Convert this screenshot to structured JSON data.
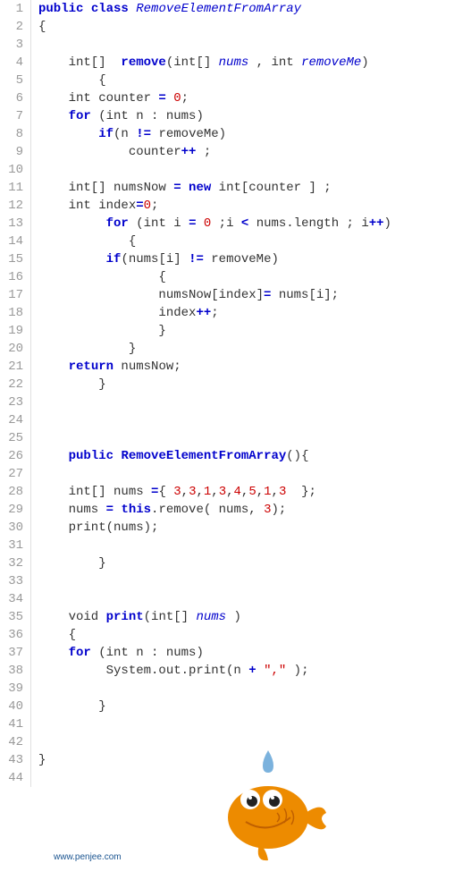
{
  "gutter": {
    "start": 1,
    "end": 44
  },
  "code": {
    "lines": [
      {
        "indent": 0,
        "tokens": [
          {
            "t": "kw",
            "v": "public"
          },
          {
            "t": "txt",
            "v": " "
          },
          {
            "t": "kw",
            "v": "class"
          },
          {
            "t": "txt",
            "v": " "
          },
          {
            "t": "classname",
            "v": "RemoveElementFromArray"
          }
        ]
      },
      {
        "indent": 0,
        "tokens": [
          {
            "t": "txt",
            "v": "{"
          }
        ]
      },
      {
        "indent": 0,
        "tokens": []
      },
      {
        "indent": 1,
        "tokens": [
          {
            "t": "txt",
            "v": "int[]  "
          },
          {
            "t": "method",
            "v": "remove"
          },
          {
            "t": "txt",
            "v": "(int[] "
          },
          {
            "t": "ident",
            "v": "nums"
          },
          {
            "t": "txt",
            "v": " , int "
          },
          {
            "t": "ident",
            "v": "removeMe"
          },
          {
            "t": "txt",
            "v": ")"
          }
        ]
      },
      {
        "indent": 2,
        "tokens": [
          {
            "t": "txt",
            "v": "{"
          }
        ]
      },
      {
        "indent": 1,
        "tokens": [
          {
            "t": "txt",
            "v": "int counter "
          },
          {
            "t": "op",
            "v": "="
          },
          {
            "t": "txt",
            "v": " "
          },
          {
            "t": "num",
            "v": "0"
          },
          {
            "t": "txt",
            "v": ";"
          }
        ]
      },
      {
        "indent": 1,
        "tokens": [
          {
            "t": "kw",
            "v": "for"
          },
          {
            "t": "txt",
            "v": " (int n : nums)"
          }
        ]
      },
      {
        "indent": 2,
        "tokens": [
          {
            "t": "kw",
            "v": "if"
          },
          {
            "t": "txt",
            "v": "(n "
          },
          {
            "t": "op",
            "v": "!="
          },
          {
            "t": "txt",
            "v": " removeMe)"
          }
        ]
      },
      {
        "indent": 3,
        "tokens": [
          {
            "t": "txt",
            "v": "counter"
          },
          {
            "t": "op",
            "v": "++"
          },
          {
            "t": "txt",
            "v": " ;"
          }
        ]
      },
      {
        "indent": 0,
        "tokens": []
      },
      {
        "indent": 1,
        "tokens": [
          {
            "t": "txt",
            "v": "int[] numsNow "
          },
          {
            "t": "op",
            "v": "="
          },
          {
            "t": "txt",
            "v": " "
          },
          {
            "t": "kw",
            "v": "new"
          },
          {
            "t": "txt",
            "v": " int[counter ] ;"
          }
        ]
      },
      {
        "indent": 1,
        "tokens": [
          {
            "t": "txt",
            "v": "int index"
          },
          {
            "t": "op",
            "v": "="
          },
          {
            "t": "num",
            "v": "0"
          },
          {
            "t": "txt",
            "v": ";"
          }
        ]
      },
      {
        "indent": 2,
        "tokens": [
          {
            "t": "txt",
            "v": " "
          },
          {
            "t": "kw",
            "v": "for"
          },
          {
            "t": "txt",
            "v": " (int i "
          },
          {
            "t": "op",
            "v": "="
          },
          {
            "t": "txt",
            "v": " "
          },
          {
            "t": "num",
            "v": "0"
          },
          {
            "t": "txt",
            "v": " ;i "
          },
          {
            "t": "op",
            "v": "<"
          },
          {
            "t": "txt",
            "v": " nums.length ; i"
          },
          {
            "t": "op",
            "v": "++"
          },
          {
            "t": "txt",
            "v": ")"
          }
        ]
      },
      {
        "indent": 3,
        "tokens": [
          {
            "t": "txt",
            "v": "{"
          }
        ]
      },
      {
        "indent": 2,
        "tokens": [
          {
            "t": "txt",
            "v": " "
          },
          {
            "t": "kw",
            "v": "if"
          },
          {
            "t": "txt",
            "v": "(nums[i] "
          },
          {
            "t": "op",
            "v": "!="
          },
          {
            "t": "txt",
            "v": " removeMe)"
          }
        ]
      },
      {
        "indent": 4,
        "tokens": [
          {
            "t": "txt",
            "v": "{"
          }
        ]
      },
      {
        "indent": 4,
        "tokens": [
          {
            "t": "txt",
            "v": "numsNow[index]"
          },
          {
            "t": "op",
            "v": "="
          },
          {
            "t": "txt",
            "v": " nums[i];"
          }
        ]
      },
      {
        "indent": 4,
        "tokens": [
          {
            "t": "txt",
            "v": "index"
          },
          {
            "t": "op",
            "v": "++"
          },
          {
            "t": "txt",
            "v": ";"
          }
        ]
      },
      {
        "indent": 4,
        "tokens": [
          {
            "t": "txt",
            "v": "}"
          }
        ]
      },
      {
        "indent": 3,
        "tokens": [
          {
            "t": "txt",
            "v": "}"
          }
        ]
      },
      {
        "indent": 1,
        "tokens": [
          {
            "t": "kw",
            "v": "return"
          },
          {
            "t": "txt",
            "v": " numsNow;"
          }
        ]
      },
      {
        "indent": 2,
        "tokens": [
          {
            "t": "txt",
            "v": "}"
          }
        ]
      },
      {
        "indent": 0,
        "tokens": []
      },
      {
        "indent": 0,
        "tokens": []
      },
      {
        "indent": 0,
        "tokens": []
      },
      {
        "indent": 1,
        "tokens": [
          {
            "t": "kw",
            "v": "public"
          },
          {
            "t": "txt",
            "v": " "
          },
          {
            "t": "method",
            "v": "RemoveElementFromArray"
          },
          {
            "t": "txt",
            "v": "(){"
          }
        ]
      },
      {
        "indent": 0,
        "tokens": []
      },
      {
        "indent": 1,
        "tokens": [
          {
            "t": "txt",
            "v": "int[] nums "
          },
          {
            "t": "op",
            "v": "="
          },
          {
            "t": "txt",
            "v": "{ "
          },
          {
            "t": "num",
            "v": "3"
          },
          {
            "t": "txt",
            "v": ","
          },
          {
            "t": "num",
            "v": "3"
          },
          {
            "t": "txt",
            "v": ","
          },
          {
            "t": "num",
            "v": "1"
          },
          {
            "t": "txt",
            "v": ","
          },
          {
            "t": "num",
            "v": "3"
          },
          {
            "t": "txt",
            "v": ","
          },
          {
            "t": "num",
            "v": "4"
          },
          {
            "t": "txt",
            "v": ","
          },
          {
            "t": "num",
            "v": "5"
          },
          {
            "t": "txt",
            "v": ","
          },
          {
            "t": "num",
            "v": "1"
          },
          {
            "t": "txt",
            "v": ","
          },
          {
            "t": "num",
            "v": "3"
          },
          {
            "t": "txt",
            "v": "  };"
          }
        ]
      },
      {
        "indent": 1,
        "tokens": [
          {
            "t": "txt",
            "v": "nums "
          },
          {
            "t": "op",
            "v": "="
          },
          {
            "t": "txt",
            "v": " "
          },
          {
            "t": "kw",
            "v": "this"
          },
          {
            "t": "txt",
            "v": ".remove( nums, "
          },
          {
            "t": "num",
            "v": "3"
          },
          {
            "t": "txt",
            "v": ");"
          }
        ]
      },
      {
        "indent": 1,
        "tokens": [
          {
            "t": "txt",
            "v": "print(nums);"
          }
        ]
      },
      {
        "indent": 0,
        "tokens": []
      },
      {
        "indent": 2,
        "tokens": [
          {
            "t": "txt",
            "v": "}"
          }
        ]
      },
      {
        "indent": 0,
        "tokens": []
      },
      {
        "indent": 0,
        "tokens": []
      },
      {
        "indent": 1,
        "tokens": [
          {
            "t": "txt",
            "v": "void "
          },
          {
            "t": "method",
            "v": "print"
          },
          {
            "t": "txt",
            "v": "(int[] "
          },
          {
            "t": "ident",
            "v": "nums"
          },
          {
            "t": "txt",
            "v": " )"
          }
        ]
      },
      {
        "indent": 1,
        "tokens": [
          {
            "t": "txt",
            "v": "{"
          }
        ]
      },
      {
        "indent": 1,
        "tokens": [
          {
            "t": "kw",
            "v": "for"
          },
          {
            "t": "txt",
            "v": " (int n : nums)"
          }
        ]
      },
      {
        "indent": 2,
        "tokens": [
          {
            "t": "txt",
            "v": " System.out.print(n "
          },
          {
            "t": "op",
            "v": "+"
          },
          {
            "t": "txt",
            "v": " "
          },
          {
            "t": "str",
            "v": "\",\""
          },
          {
            "t": "txt",
            "v": " );"
          }
        ]
      },
      {
        "indent": 0,
        "tokens": []
      },
      {
        "indent": 2,
        "tokens": [
          {
            "t": "txt",
            "v": "}"
          }
        ]
      },
      {
        "indent": 0,
        "tokens": []
      },
      {
        "indent": 0,
        "tokens": []
      },
      {
        "indent": 0,
        "tokens": [
          {
            "t": "txt",
            "v": "}"
          }
        ]
      },
      {
        "indent": 0,
        "tokens": []
      }
    ]
  },
  "footer": {
    "text": "www.penjee.com"
  },
  "mascot": {
    "name": "penjee-fish"
  }
}
